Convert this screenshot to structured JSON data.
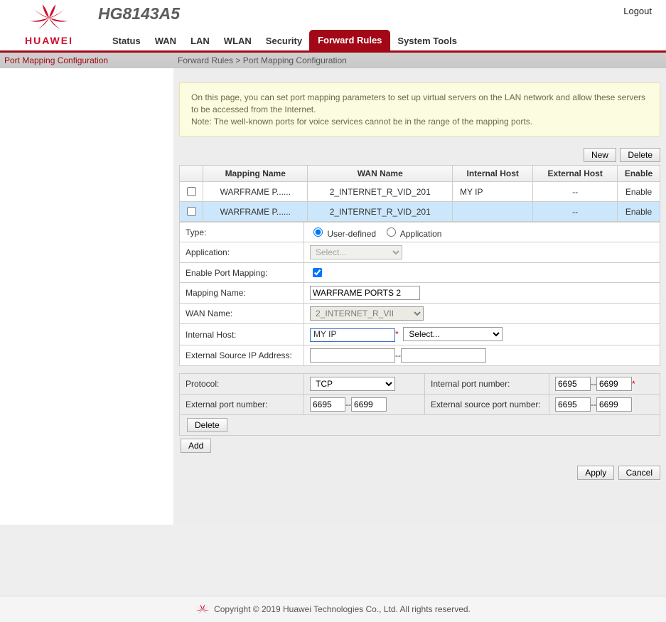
{
  "header": {
    "brand": "HUAWEI",
    "model": "HG8143A5",
    "logout": "Logout"
  },
  "nav": {
    "items": [
      "Status",
      "WAN",
      "LAN",
      "WLAN",
      "Security",
      "Forward Rules",
      "System Tools"
    ],
    "active_index": 5
  },
  "sidebar": {
    "title": "Port Mapping Configuration"
  },
  "breadcrumb": "Forward Rules > Port Mapping Configuration",
  "info": {
    "line1": "On this page, you can set port mapping parameters to set up virtual servers on the LAN network and allow these servers to be accessed from the Internet.",
    "line2": "Note: The well-known ports for voice services cannot be in the range of the mapping ports."
  },
  "buttons": {
    "new": "New",
    "delete": "Delete",
    "add": "Add",
    "apply": "Apply",
    "cancel": "Cancel"
  },
  "table": {
    "headers": [
      "",
      "Mapping Name",
      "WAN Name",
      "Internal Host",
      "External Host",
      "Enable"
    ],
    "rows": [
      {
        "mapping": "WARFRAME P......",
        "wan": "2_INTERNET_R_VID_201",
        "ihost": "MY IP",
        "ehost": "--",
        "enable": "Enable"
      },
      {
        "mapping": "WARFRAME P......",
        "wan": "2_INTERNET_R_VID_201",
        "ihost": "",
        "ehost": "--",
        "enable": "Enable"
      }
    ]
  },
  "form": {
    "type_label": "Type:",
    "type_user": "User-defined",
    "type_app": "Application",
    "app_label": "Application:",
    "app_value": "Select...",
    "enable_label": "Enable Port Mapping:",
    "mapping_label": "Mapping Name:",
    "mapping_value": "WARFRAME PORTS 2",
    "wan_label": "WAN Name:",
    "wan_value": "2_INTERNET_R_VII",
    "ihost_label": "Internal Host:",
    "ihost_value": "MY IP",
    "ihost_select": "Select...",
    "ext_src_label": "External Source IP Address:",
    "ext_src_start": "",
    "ext_src_end": ""
  },
  "ports": {
    "protocol_label": "Protocol:",
    "protocol_value": "TCP",
    "internal_label": "Internal port number:",
    "internal_start": "6695",
    "internal_end": "6699",
    "external_label": "External port number:",
    "external_start": "6695",
    "external_end": "6699",
    "ext_src_port_label": "External source port number:",
    "ext_src_port_start": "6695",
    "ext_src_port_end": "6699"
  },
  "footer": {
    "text": "Copyright © 2019 Huawei Technologies Co., Ltd. All rights reserved."
  }
}
